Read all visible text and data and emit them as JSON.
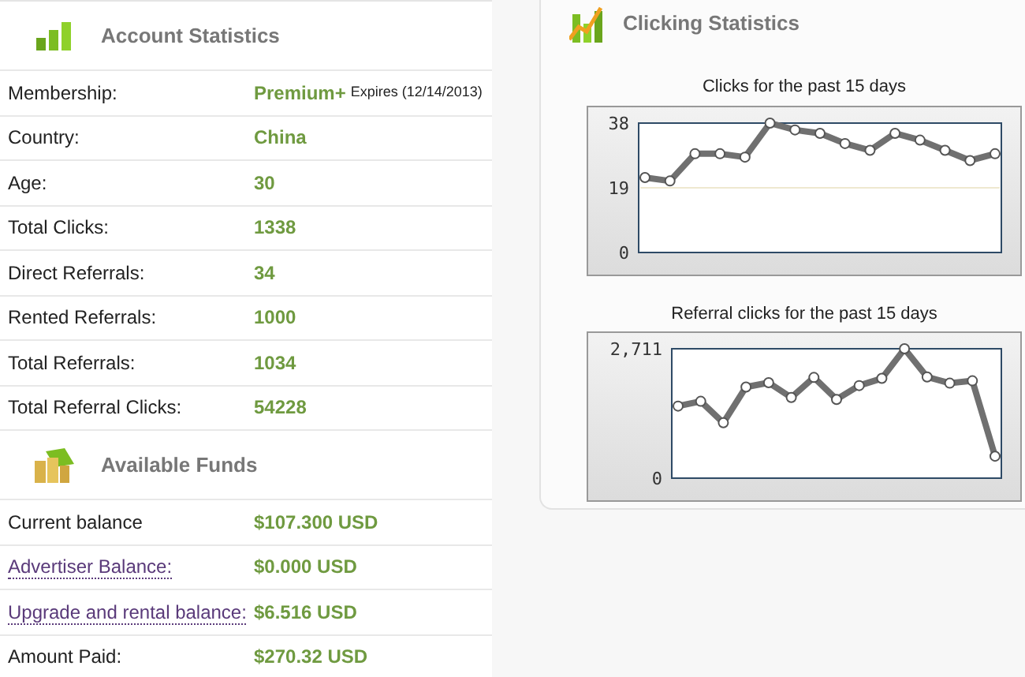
{
  "account_statistics": {
    "title": "Account Statistics",
    "rows": [
      {
        "label": "Membership:",
        "value": "Premium+",
        "note": "Expires (12/14/2013)"
      },
      {
        "label": "Country:",
        "value": "China"
      },
      {
        "label": "Age:",
        "value": "30"
      },
      {
        "label": "Total Clicks:",
        "value": "1338"
      },
      {
        "label": "Direct Referrals:",
        "value": "34"
      },
      {
        "label": "Rented Referrals:",
        "value": "1000"
      },
      {
        "label": "Total Referrals:",
        "value": "1034"
      },
      {
        "label": "Total Referral Clicks:",
        "value": "54228"
      }
    ]
  },
  "available_funds": {
    "title": "Available Funds",
    "rows": [
      {
        "label": "Current balance",
        "value": "$107.300 USD",
        "kind": "text"
      },
      {
        "label": "Advertiser Balance:",
        "value": "$0.000 USD",
        "kind": "link"
      },
      {
        "label": "Upgrade and rental balance:",
        "value": "$6.516 USD",
        "kind": "link"
      },
      {
        "label": "Amount Paid:",
        "value": "$270.32 USD",
        "kind": "text"
      }
    ]
  },
  "clicking_statistics": {
    "title": "Clicking Statistics",
    "charts": [
      {
        "chart_data": {
          "type": "line",
          "title": "Clicks for the past 15 days",
          "ylim": [
            0,
            38
          ],
          "yticks": [
            0,
            19,
            38
          ],
          "series": [
            {
              "color": "#707070",
              "marker": true,
              "values": [
                22,
                21,
                29,
                29,
                28,
                38,
                36,
                35,
                32,
                30,
                35,
                33,
                30,
                27,
                29
              ]
            }
          ]
        }
      },
      {
        "chart_data": {
          "type": "line",
          "title": "Referral clicks for the past 15 days",
          "ylim": [
            0,
            2711
          ],
          "yticks": [
            0,
            {
              "value": 2711,
              "label": "2,711"
            }
          ],
          "series": [
            {
              "color": "#707070",
              "marker": true,
              "values": [
                1510,
                1610,
                1160,
                1910,
                2000,
                1690,
                2110,
                1650,
                1940,
                2090,
                2710,
                2120,
                1990,
                2040,
                460
              ]
            }
          ]
        }
      }
    ]
  }
}
